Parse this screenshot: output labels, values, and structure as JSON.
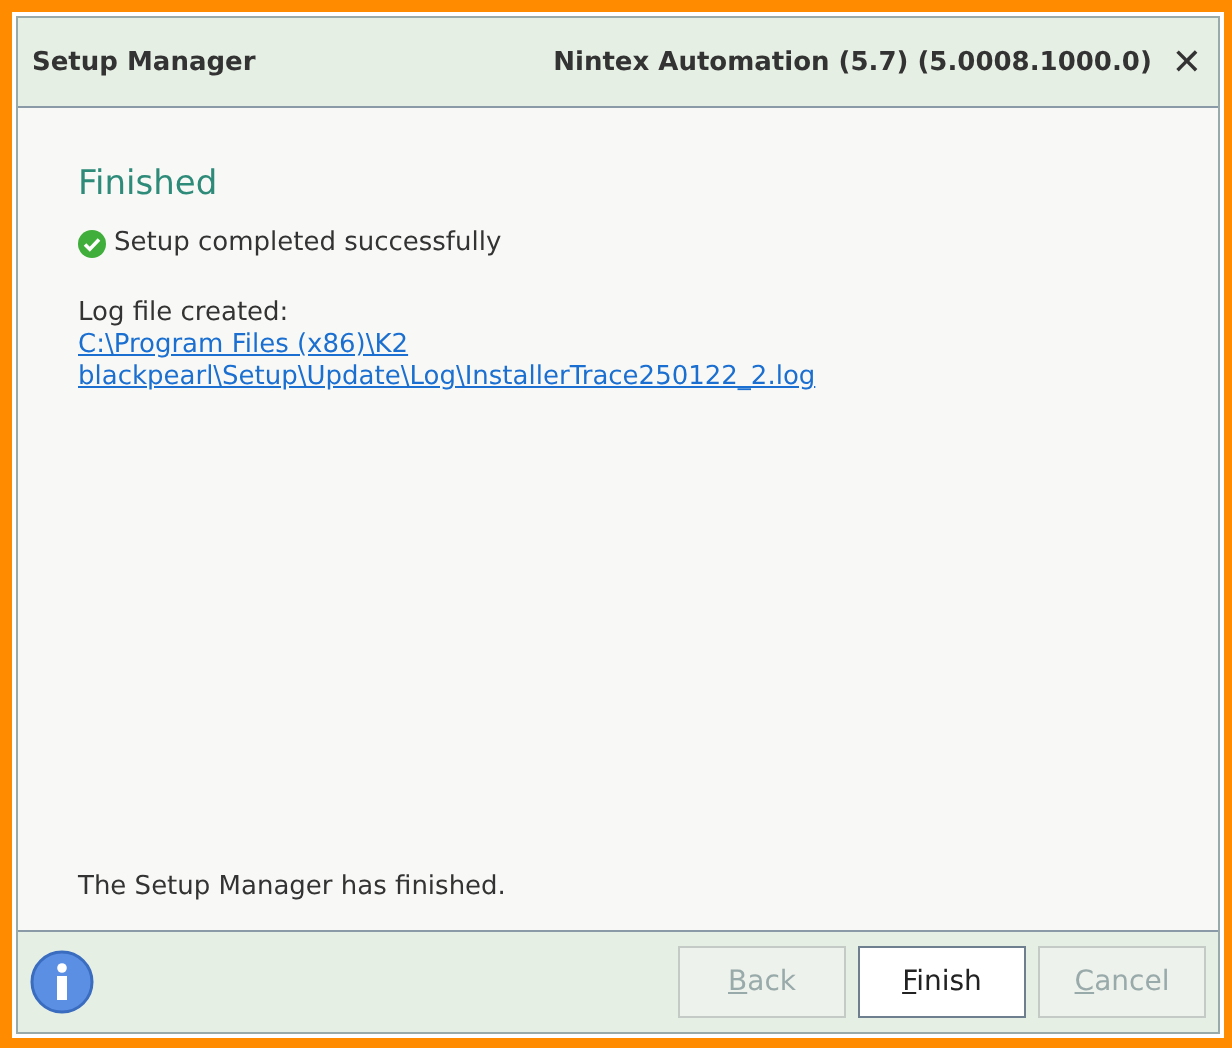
{
  "window": {
    "title": "Setup Manager",
    "product": "Nintex Automation (5.7) (5.0008.1000.0)",
    "close": "✕"
  },
  "heading": "Finished",
  "status": {
    "kind": "success",
    "text": "Setup completed successfully"
  },
  "log": {
    "label": "Log file created:",
    "link_lines": [
      "C:\\Program Files (x86)\\K2",
      "blackpearl\\Setup\\Update\\Log\\InstallerTrace250122_2.log"
    ]
  },
  "footer_text": "The Setup Manager has finished.",
  "buttons": [
    {
      "access_key": "B",
      "rest": "ack",
      "disabled": true
    },
    {
      "access_key": "F",
      "rest": "inish",
      "disabled": false
    },
    {
      "access_key": "C",
      "rest": "ancel",
      "disabled": true
    }
  ]
}
